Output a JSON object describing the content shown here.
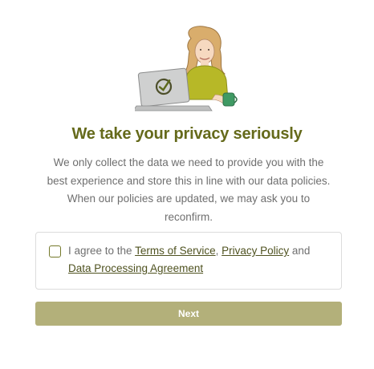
{
  "header": {
    "illustration_icon": "woman-with-laptop-illustration",
    "title": "We take your privacy seriously"
  },
  "intro": {
    "line1": "We only collect the data we need to provide you with the",
    "line2": "best experience and store this in line with our data policies.",
    "line3": "When our policies are updated, we may ask you to",
    "line4": "reconfirm."
  },
  "consent": {
    "checked": false,
    "prefix": "I agree to the ",
    "terms_link": "Terms of Service",
    "comma": ", ",
    "privacy_link": "Privacy Policy",
    "and": " and",
    "dpa_link": "Data Processing Agreement"
  },
  "actions": {
    "next_label": "Next"
  },
  "colors": {
    "title": "#656a1b",
    "accent": "#74792a",
    "button": "#b3b07a"
  }
}
